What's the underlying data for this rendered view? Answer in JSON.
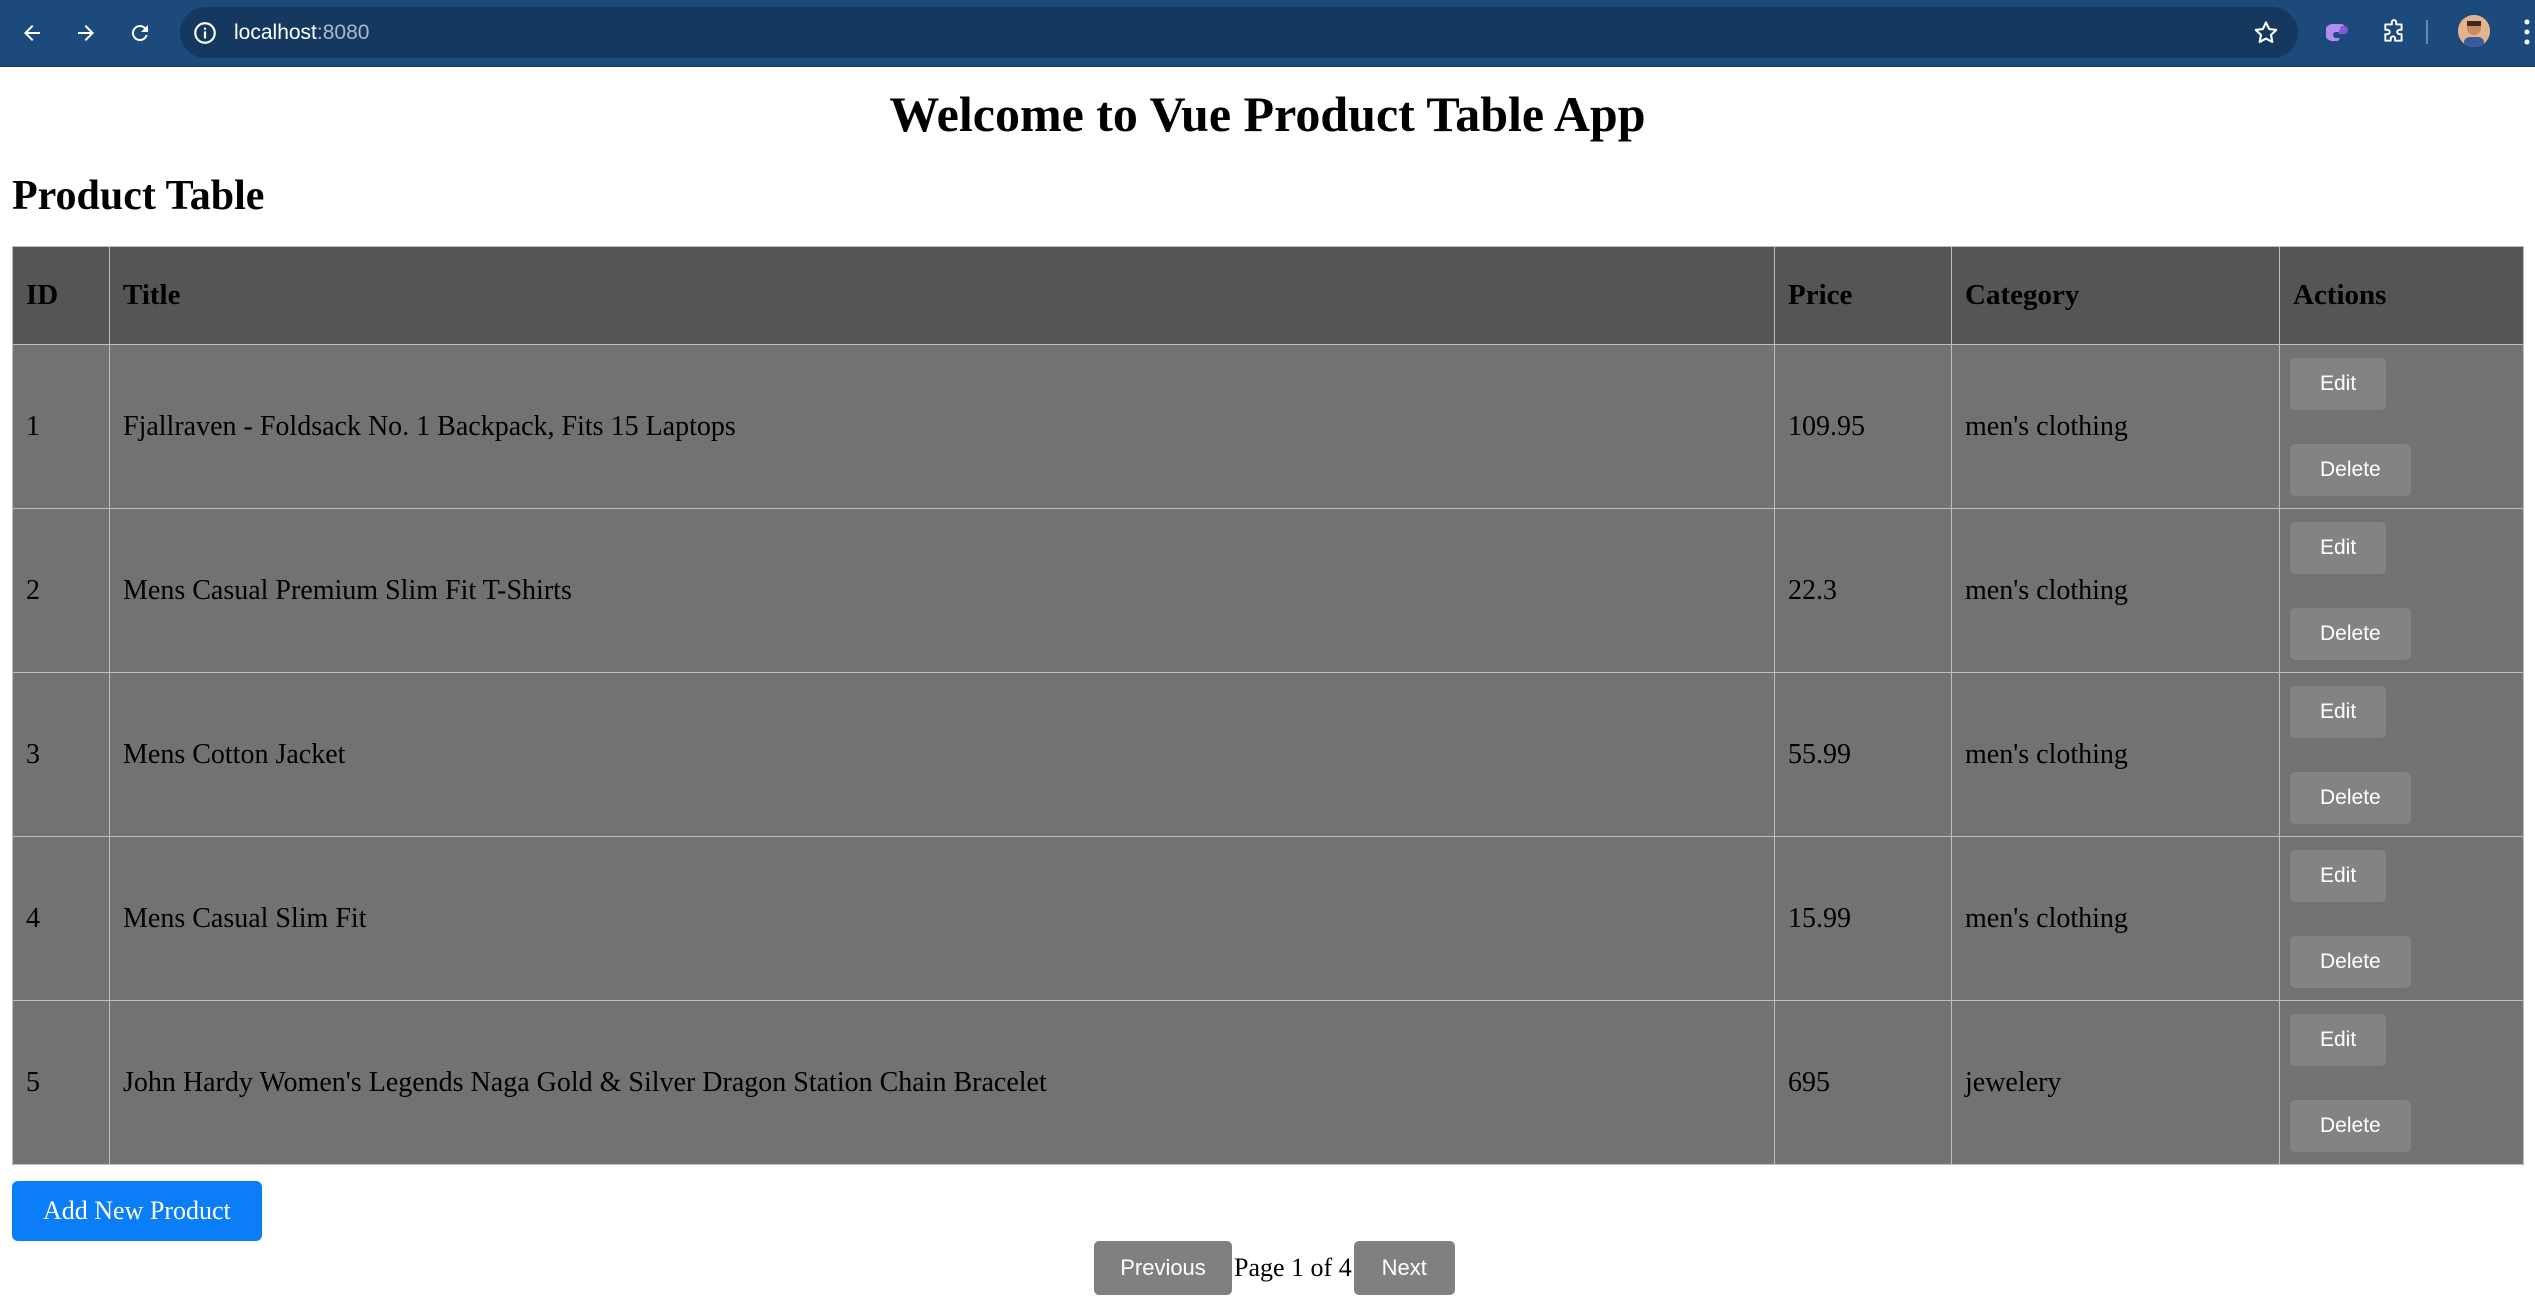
{
  "browser": {
    "url_host": "localhost",
    "url_port": ":8080"
  },
  "page": {
    "app_title": "Welcome to Vue Product Table App",
    "table_title": "Product Table"
  },
  "table": {
    "columns": [
      "ID",
      "Title",
      "Price",
      "Category",
      "Actions"
    ],
    "rows": [
      {
        "id": "1",
        "title": "Fjallraven - Foldsack No. 1 Backpack, Fits 15 Laptops",
        "price": "109.95",
        "category": "men's clothing"
      },
      {
        "id": "2",
        "title": "Mens Casual Premium Slim Fit T-Shirts",
        "price": "22.3",
        "category": "men's clothing"
      },
      {
        "id": "3",
        "title": "Mens Cotton Jacket",
        "price": "55.99",
        "category": "men's clothing"
      },
      {
        "id": "4",
        "title": "Mens Casual Slim Fit",
        "price": "15.99",
        "category": "men's clothing"
      },
      {
        "id": "5",
        "title": "John Hardy Women's Legends Naga Gold & Silver Dragon Station Chain Bracelet",
        "price": "695",
        "category": "jewelery"
      }
    ],
    "edit_label": "Edit",
    "delete_label": "Delete"
  },
  "add_button_label": "Add New Product",
  "pagination": {
    "previous_label": "Previous",
    "page_info": "Page 1 of 4",
    "next_label": "Next"
  },
  "colors": {
    "chrome": "#1d4a7c",
    "header_bg": "#555555",
    "row_bg": "#727272",
    "accent": "#0b7df7"
  }
}
